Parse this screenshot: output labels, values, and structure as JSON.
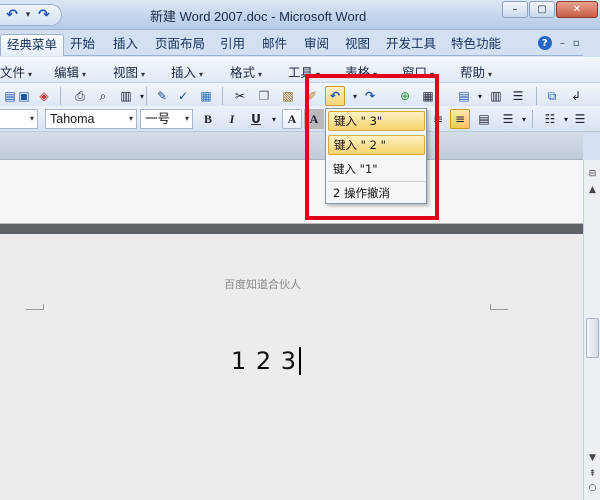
{
  "window": {
    "title": "新建 Word 2007.doc - Microsoft Word",
    "minimize": "–",
    "restore": "▢",
    "close": "✕"
  },
  "qat": {
    "undo": "↶",
    "sep": "▾",
    "redo": "↷"
  },
  "ribbon_tabs": [
    {
      "label": "经典菜单"
    },
    {
      "label": "开始"
    },
    {
      "label": "插入"
    },
    {
      "label": "页面布局"
    },
    {
      "label": "引用"
    },
    {
      "label": "邮件"
    },
    {
      "label": "审阅"
    },
    {
      "label": "视图"
    },
    {
      "label": "开发工具"
    },
    {
      "label": "特色功能"
    }
  ],
  "ribbon_right": {
    "help": "?",
    "min": "–",
    "restore": "▫",
    "close": "✕"
  },
  "menus": [
    {
      "label": "文件"
    },
    {
      "label": "编辑"
    },
    {
      "label": "视图"
    },
    {
      "label": "插入"
    },
    {
      "label": "格式"
    },
    {
      "label": "工具"
    },
    {
      "label": "表格"
    },
    {
      "label": "窗口"
    },
    {
      "label": "帮助"
    }
  ],
  "toolbar2": {
    "font_name": "Tahoma",
    "font_size": "一号",
    "bold": "B",
    "italic": "I",
    "underline": "U",
    "char_border": "A",
    "char_shade": "A"
  },
  "undo_dropdown": {
    "items": [
      {
        "label": "键入 \" 3\""
      },
      {
        "label": "键入 \" 2 \""
      },
      {
        "label": "键入 \"1\""
      }
    ],
    "footer": "2 操作撤消"
  },
  "document": {
    "watermark": "百度知道合伙人",
    "body_text": "1 2  3"
  },
  "colors": {
    "highlight": "#e3001b",
    "accent": "#2467c6"
  }
}
